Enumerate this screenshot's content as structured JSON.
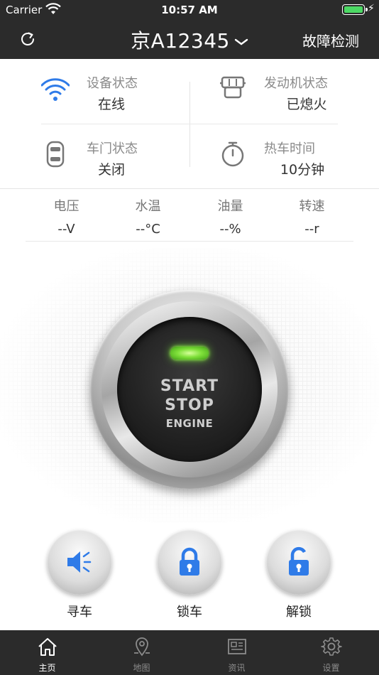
{
  "status_bar": {
    "carrier": "Carrier",
    "time": "10:57 AM"
  },
  "header": {
    "plate": "京A12345",
    "fault_check": "故障检测"
  },
  "status": {
    "device": {
      "label": "设备状态",
      "value": "在线"
    },
    "engine": {
      "label": "发动机状态",
      "value": "已熄火"
    },
    "door": {
      "label": "车门状态",
      "value": "关闭"
    },
    "warmup": {
      "label": "热车时间",
      "value": "10分钟"
    }
  },
  "metrics": [
    {
      "label": "电压",
      "value": "--V"
    },
    {
      "label": "水温",
      "value": "--°C"
    },
    {
      "label": "油量",
      "value": "--%"
    },
    {
      "label": "转速",
      "value": "--r"
    }
  ],
  "engine_button": {
    "line1": "START",
    "line2": "STOP",
    "line3": "ENGINE"
  },
  "actions": [
    {
      "label": "寻车",
      "icon": "speaker-icon"
    },
    {
      "label": "锁车",
      "icon": "lock-icon"
    },
    {
      "label": "解锁",
      "icon": "unlock-icon"
    }
  ],
  "tabs": [
    {
      "label": "主页",
      "icon": "home-icon",
      "active": true
    },
    {
      "label": "地图",
      "icon": "map-pin-icon",
      "active": false
    },
    {
      "label": "资讯",
      "icon": "news-icon",
      "active": false
    },
    {
      "label": "设置",
      "icon": "gear-icon",
      "active": false
    }
  ],
  "colors": {
    "header_bg": "#2b2b2b",
    "accent_blue": "#2f7be8",
    "led_green": "#7fe03a",
    "battery_green": "#4cd964"
  }
}
